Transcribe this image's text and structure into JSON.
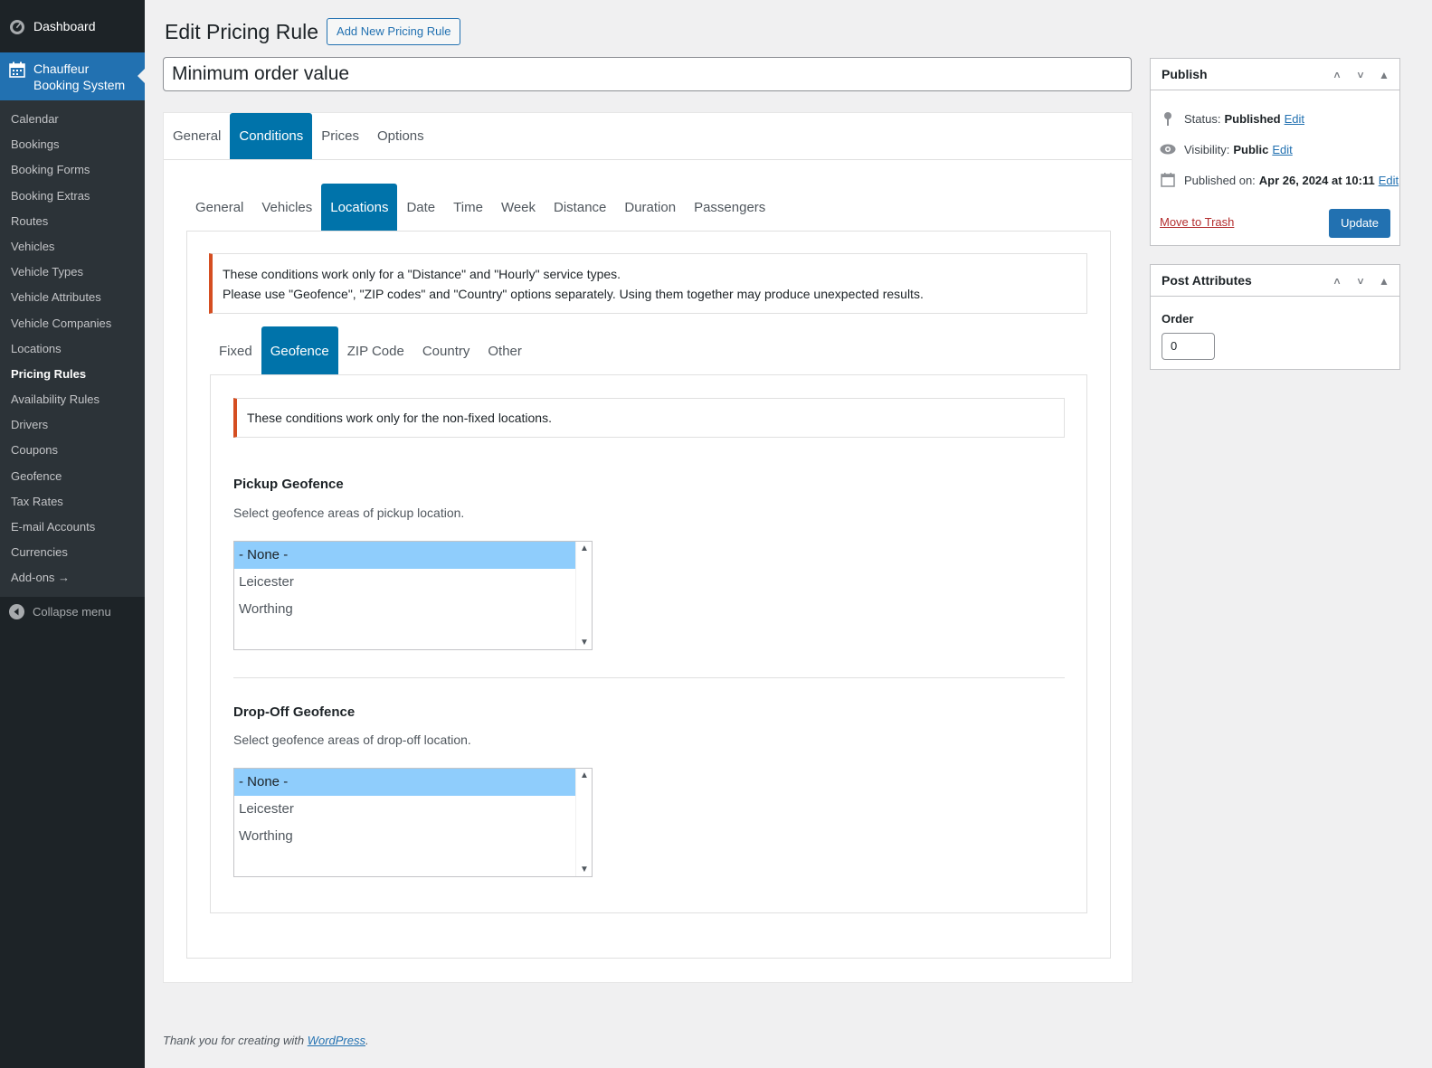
{
  "sidebar": {
    "dashboard": "Dashboard",
    "plugin_line1": "Chauffeur",
    "plugin_line2": "Booking System",
    "items": [
      {
        "label": "Calendar"
      },
      {
        "label": "Bookings"
      },
      {
        "label": "Booking Forms"
      },
      {
        "label": "Booking Extras"
      },
      {
        "label": "Routes"
      },
      {
        "label": "Vehicles"
      },
      {
        "label": "Vehicle Types"
      },
      {
        "label": "Vehicle Attributes"
      },
      {
        "label": "Vehicle Companies"
      },
      {
        "label": "Locations"
      },
      {
        "label": "Pricing Rules",
        "current": true
      },
      {
        "label": "Availability Rules"
      },
      {
        "label": "Drivers"
      },
      {
        "label": "Coupons"
      },
      {
        "label": "Geofence"
      },
      {
        "label": "Tax Rates"
      },
      {
        "label": "E-mail Accounts"
      },
      {
        "label": "Currencies"
      },
      {
        "label": "Add-ons →"
      }
    ],
    "collapse": "Collapse menu"
  },
  "header": {
    "title": "Edit Pricing Rule",
    "add_new": "Add New Pricing Rule"
  },
  "post_title": "Minimum order value",
  "tabs_main": [
    "General",
    "Conditions",
    "Prices",
    "Options"
  ],
  "tabs_conditions": [
    "General",
    "Vehicles",
    "Locations",
    "Date",
    "Time",
    "Week",
    "Distance",
    "Duration",
    "Passengers"
  ],
  "notice1": {
    "line1": "These conditions work only for a \"Distance\" and \"Hourly\" service types.",
    "line2": "Please use \"Geofence\", \"ZIP codes\" and \"Country\" options separately. Using them together may produce unexpected results."
  },
  "tabs_locations": [
    "Fixed",
    "Geofence",
    "ZIP Code",
    "Country",
    "Other"
  ],
  "notice2": "These conditions work only for the non-fixed locations.",
  "pickup": {
    "title": "Pickup Geofence",
    "desc": "Select geofence areas of pickup location.",
    "options": [
      "- None -",
      "Leicester",
      "Worthing"
    ],
    "selected": "- None -"
  },
  "dropoff": {
    "title": "Drop-Off Geofence",
    "desc": "Select geofence areas of drop-off location.",
    "options": [
      "- None -",
      "Leicester",
      "Worthing"
    ],
    "selected": "- None -"
  },
  "publish": {
    "title": "Publish",
    "status_label": "Status:",
    "status_value": "Published",
    "visibility_label": "Visibility:",
    "visibility_value": "Public",
    "published_label": "Published on:",
    "published_value": "Apr 26, 2024 at 10:11",
    "edit": "Edit",
    "trash": "Move to Trash",
    "update": "Update"
  },
  "attributes": {
    "title": "Post Attributes",
    "order_label": "Order",
    "order_value": "0"
  },
  "footer": {
    "text": "Thank you for creating with ",
    "link": "WordPress",
    "end": "."
  },
  "colors": {
    "admin_bar": "#1d2327",
    "accent": "#2271b1",
    "tab_active": "#0073aa",
    "selection": "#8fcdfc",
    "notice_border": "#d54e21"
  },
  "icons": [
    "dashboard-icon",
    "calendar-icon",
    "collapse-icon",
    "pin-icon",
    "eye-icon",
    "calendar-small-icon"
  ]
}
